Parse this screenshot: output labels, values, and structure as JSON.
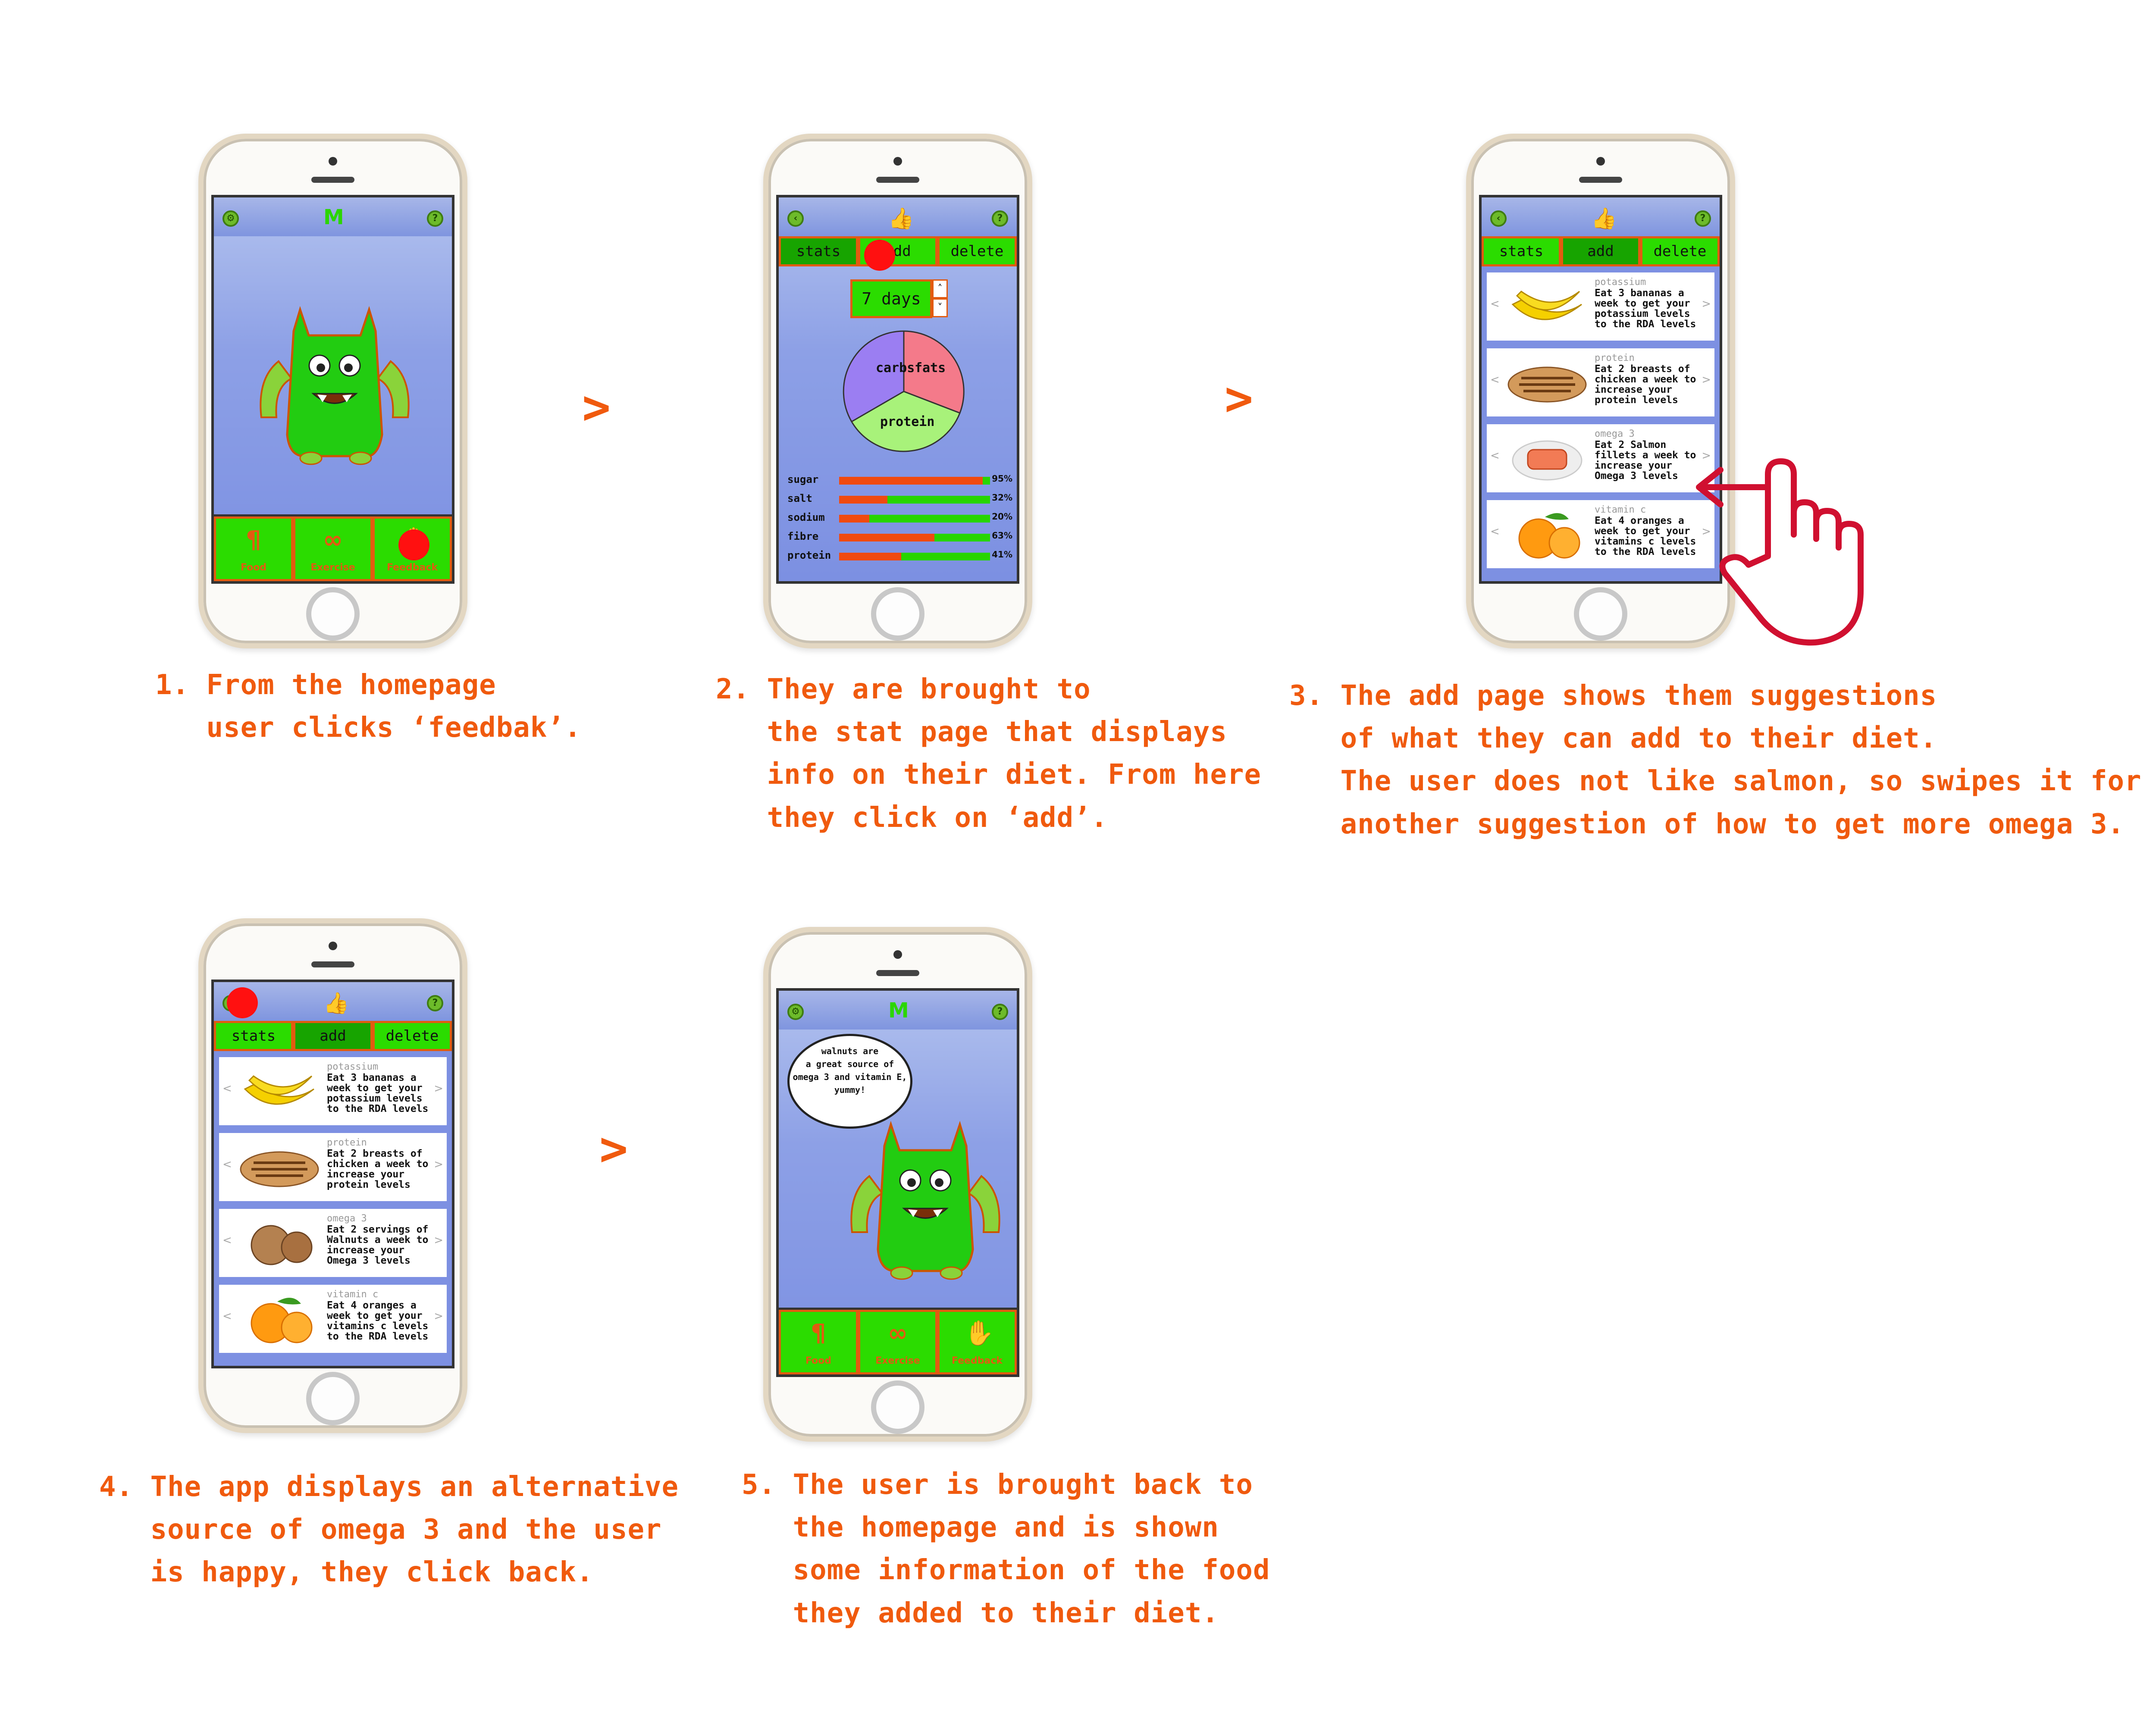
{
  "captions": {
    "step1": "1. From the homepage\n   user clicks ‘feedbak’.",
    "step2": "2. They are brought to\n   the stat page that displays\n   info on their diet. From here\n   they click on ‘add’.",
    "step3": "3. The add page shows them suggestions\n   of what they can add to their diet.\n   The user does not like salmon, so swipes it for\n   another suggestion of how to get more omega 3.",
    "step4": "4. The app displays an alternative\n   source of omega 3 and the user\n   is happy, they click back.",
    "step5": "5. The user is brought back to\n   the homepage and is shown\n   some information of the food\n   they added to their diet."
  },
  "arrows": [
    ">",
    ">",
    ">"
  ],
  "app": {
    "logo": "M",
    "nav": {
      "food": "Food",
      "exercise": "Exercise",
      "feedback": "Feedback"
    },
    "tabs": {
      "stats": "stats",
      "add": "add",
      "delete": "delete"
    },
    "days_value": "7 days",
    "pie": {
      "carbs": "carbs",
      "fats": "fats",
      "protein": "protein"
    },
    "stats": [
      {
        "label": "sugar",
        "value": 95,
        "text": "95%"
      },
      {
        "label": "salt",
        "value": 32,
        "text": "32%"
      },
      {
        "label": "sodium",
        "value": 20,
        "text": "20%"
      },
      {
        "label": "fibre",
        "value": 63,
        "text": "63%"
      },
      {
        "label": "protein",
        "value": 41,
        "text": "41%"
      }
    ],
    "suggestions_a": [
      {
        "cat": "potassium",
        "desc": "Eat 3 bananas a week to get your potassium levels to the RDA levels"
      },
      {
        "cat": "protein",
        "desc": "Eat 2 breasts of chicken a week to increase your protein levels"
      },
      {
        "cat": "omega 3",
        "desc": "Eat 2 Salmon fillets a week to increase your Omega 3 levels"
      },
      {
        "cat": "vitamin c",
        "desc": "Eat 4 oranges a week to get your vitamins c levels to the RDA levels"
      }
    ],
    "suggestions_b": [
      {
        "cat": "potassium",
        "desc": "Eat 3 bananas a week to get your potassium levels to the RDA levels"
      },
      {
        "cat": "protein",
        "desc": "Eat 2 breasts of chicken a week to increase your protein levels"
      },
      {
        "cat": "omega 3",
        "desc": "Eat 2 servings of Walnuts a week to increase your Omega 3 levels"
      },
      {
        "cat": "vitamin c",
        "desc": "Eat 4 oranges a week to get your vitamins c levels to the RDA levels"
      }
    ],
    "bubble": "walnuts are\na great source of\nomega 3 and vitamin E,\nyummy!",
    "colors": {
      "caption": "#f05a0e",
      "button": "#2bdc00",
      "button_active": "#17a400",
      "accent": "#e25b10"
    }
  }
}
